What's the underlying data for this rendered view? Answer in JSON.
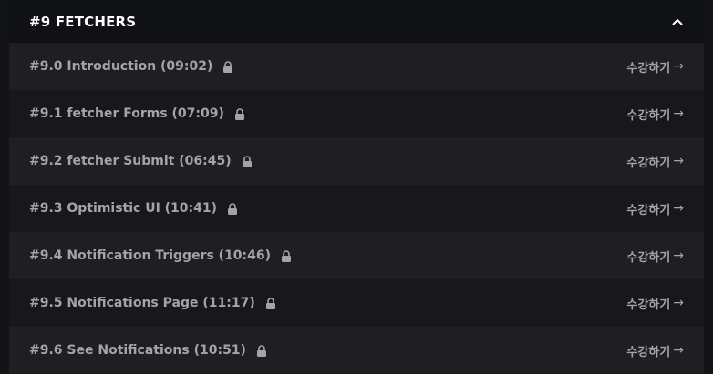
{
  "section": {
    "title": "#9 FETCHERS",
    "collapse_icon": "chevron-up-icon"
  },
  "lectures": [
    {
      "title": "#9.0 Introduction (09:02)",
      "icon": "lock-icon",
      "action": "수강하기",
      "action_icon": "arrow-right"
    },
    {
      "title": "#9.1 fetcher Forms (07:09)",
      "icon": "lock-icon",
      "action": "수강하기",
      "action_icon": "arrow-right"
    },
    {
      "title": "#9.2 fetcher Submit (06:45)",
      "icon": "lock-icon",
      "action": "수강하기",
      "action_icon": "arrow-right"
    },
    {
      "title": "#9.3 Optimistic UI (10:41)",
      "icon": "lock-icon",
      "action": "수강하기",
      "action_icon": "arrow-right"
    },
    {
      "title": "#9.4 Notification Triggers (10:46)",
      "icon": "lock-icon",
      "action": "수강하기",
      "action_icon": "arrow-right"
    },
    {
      "title": "#9.5 Notifications Page (11:17)",
      "icon": "lock-icon",
      "action": "수강하기",
      "action_icon": "arrow-right"
    },
    {
      "title": "#9.6 See Notifications (10:51)",
      "icon": "lock-icon",
      "action": "수강하기",
      "action_icon": "arrow-right"
    }
  ],
  "colors": {
    "header_bg": "#0f1114",
    "row_bg_odd": "#1f1f22",
    "row_bg_even": "#18181b",
    "text": "#a2a4a9",
    "title": "#ffffff"
  }
}
